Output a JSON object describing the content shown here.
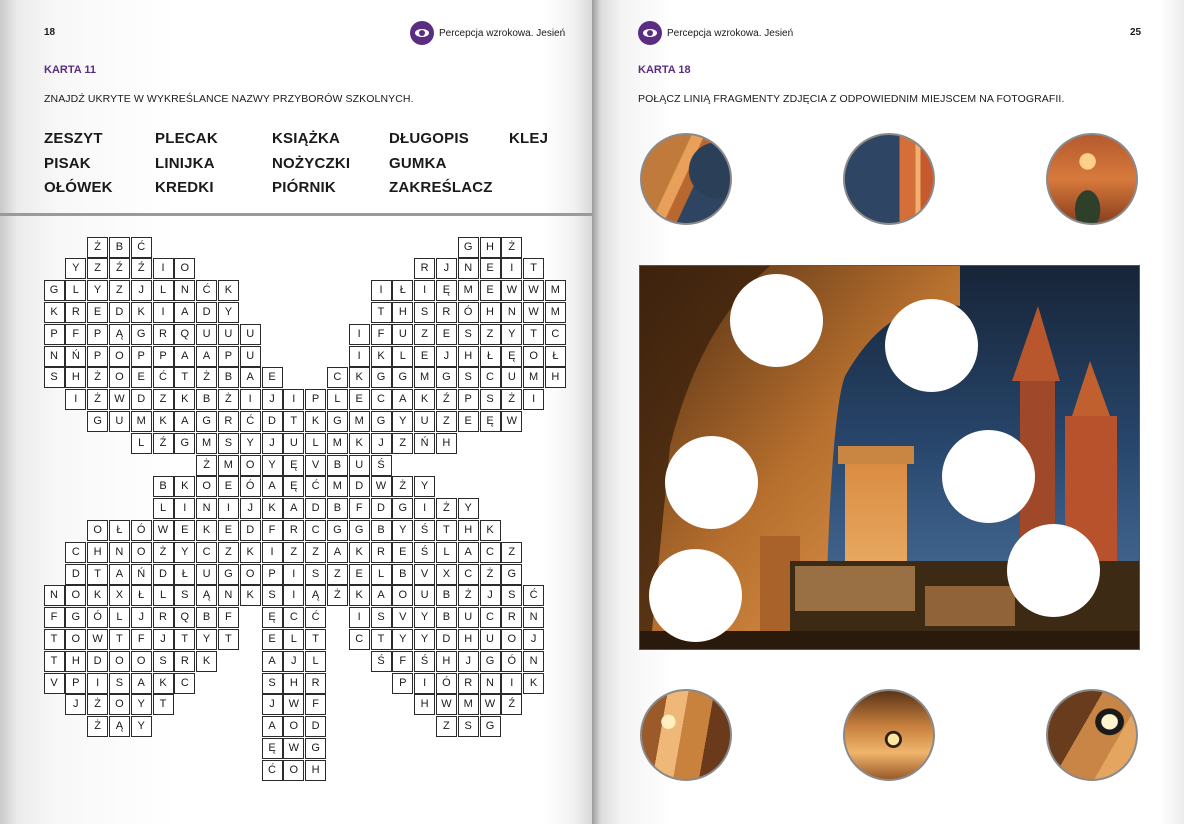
{
  "left_page": {
    "page_number": "18",
    "header": "Percepcja wzrokowa. Jesień",
    "card_title": "KARTA 11",
    "instruction": "ZNAJDŹ UKRYTE W WYKREŚLANCE NAZWY PRZYBORÓW SZKOLNYCH.",
    "words": [
      [
        "ZESZYT",
        "PLECAK",
        "KSIĄŻKA",
        "DŁUGOPIS",
        "KLEJ"
      ],
      [
        "PISAK",
        "LINIJKA",
        "NOŻYCZKI",
        "GUMKA"
      ],
      [
        "OŁÓWEK",
        "KREDKI",
        "PIÓRNIK",
        "ZAKREŚLACZ"
      ]
    ],
    "puzzle_rows": [
      {
        "segments": [
          {
            "start": 2,
            "letters": "ŻBĆ"
          },
          {
            "start": 19,
            "letters": "GHŻ"
          }
        ]
      },
      {
        "segments": [
          {
            "start": 1,
            "letters": "YZŹŹIO"
          },
          {
            "start": 17,
            "letters": "RJNEIT"
          }
        ]
      },
      {
        "segments": [
          {
            "start": 0,
            "letters": "GLYZJLNĆK"
          },
          {
            "start": 15,
            "letters": "IŁIĘMEWWM"
          }
        ]
      },
      {
        "segments": [
          {
            "start": 0,
            "letters": "KREDKIADY"
          },
          {
            "start": 15,
            "letters": "THSRÓHNWM"
          }
        ]
      },
      {
        "segments": [
          {
            "start": 0,
            "letters": "PFPĄGRQUUU"
          },
          {
            "start": 14,
            "letters": "IFUZESZYTC"
          }
        ]
      },
      {
        "segments": [
          {
            "start": 0,
            "letters": "NŃPOPPAAPU"
          },
          {
            "start": 14,
            "letters": "IKLEJHŁĘOŁ"
          }
        ]
      },
      {
        "segments": [
          {
            "start": 0,
            "letters": "SHŻOEĆTŻBAE"
          },
          {
            "start": 13,
            "letters": "CKGGMGSCUMH"
          }
        ]
      },
      {
        "segments": [
          {
            "start": 1,
            "letters": "IŻWDZKBŻIJIPLECAKŹPSŻI"
          }
        ]
      },
      {
        "segments": [
          {
            "start": 2,
            "letters": "GUMKAGRĆDTKGMGYUZEĘW"
          }
        ]
      },
      {
        "segments": [
          {
            "start": 4,
            "letters": "LŹGMSYJULMKJZŃH"
          }
        ]
      },
      {
        "segments": [
          {
            "start": 7,
            "letters": "ŻMOYĘVBUŚ"
          }
        ]
      },
      {
        "segments": [
          {
            "start": 5,
            "letters": "BKOEÓAĘĆMDWŻY"
          }
        ]
      },
      {
        "segments": [
          {
            "start": 5,
            "letters": "LINIJKADBFDGIŻY"
          }
        ]
      },
      {
        "segments": [
          {
            "start": 2,
            "letters": "OŁÓWEKEDFRCGGBYŚTHK"
          }
        ]
      },
      {
        "segments": [
          {
            "start": 1,
            "letters": "CHNOŻYCZKIZZAKREŚLACZ"
          }
        ]
      },
      {
        "segments": [
          {
            "start": 1,
            "letters": "DTAŃDŁUGOPISZELBVXCŻG"
          }
        ]
      },
      {
        "segments": [
          {
            "start": 0,
            "letters": "NOKXŁLSĄNKSIĄŻKAOUBŻJSĆ"
          }
        ]
      },
      {
        "segments": [
          {
            "start": 0,
            "letters": "FGÓLJRQBF"
          },
          {
            "start": 10,
            "letters": "ĘCĆ"
          },
          {
            "start": 14,
            "letters": "ISVYBUCRN"
          }
        ]
      },
      {
        "segments": [
          {
            "start": 0,
            "letters": "TOWTFJTYT"
          },
          {
            "start": 10,
            "letters": "ELT"
          },
          {
            "start": 14,
            "letters": "CTYYDHUOJ"
          }
        ]
      },
      {
        "segments": [
          {
            "start": 0,
            "letters": "THDOOSRK"
          },
          {
            "start": 10,
            "letters": "AJL"
          },
          {
            "start": 15,
            "letters": "ŚFŚHJGÓN"
          }
        ]
      },
      {
        "segments": [
          {
            "start": 0,
            "letters": "VPISAKC"
          },
          {
            "start": 10,
            "letters": "SHR"
          },
          {
            "start": 16,
            "letters": "PIÓRNIK"
          }
        ]
      },
      {
        "segments": [
          {
            "start": 1,
            "letters": "JŻOYT"
          },
          {
            "start": 10,
            "letters": "JWF"
          },
          {
            "start": 17,
            "letters": "HWMWŹ"
          }
        ]
      },
      {
        "segments": [
          {
            "start": 2,
            "letters": "ŻĄY"
          },
          {
            "start": 10,
            "letters": "AOD"
          },
          {
            "start": 18,
            "letters": "ZSG"
          }
        ]
      },
      {
        "segments": [
          {
            "start": 10,
            "letters": "ĘWG"
          }
        ]
      },
      {
        "segments": [
          {
            "start": 10,
            "letters": "ĆOH"
          }
        ]
      }
    ]
  },
  "right_page": {
    "page_number": "25",
    "header": "Percepcja wzrokowa. Jesień",
    "card_title": "KARTA 18",
    "instruction": "POŁĄCZ LINIĄ FRAGMENTY ZDJĘCIA Z ODPOWIEDNIM MIEJSCEM NA FOTOGRAFII.",
    "top_fragments": [
      "arch-vault-fragment",
      "tower-fragment",
      "church-facade-fragment"
    ],
    "bottom_fragments": [
      "arcade-fragment",
      "hanging-lamp-fragment",
      "lantern-fragment"
    ],
    "photo_subject": "kraków-market-square-night-photo",
    "holes": 6
  }
}
